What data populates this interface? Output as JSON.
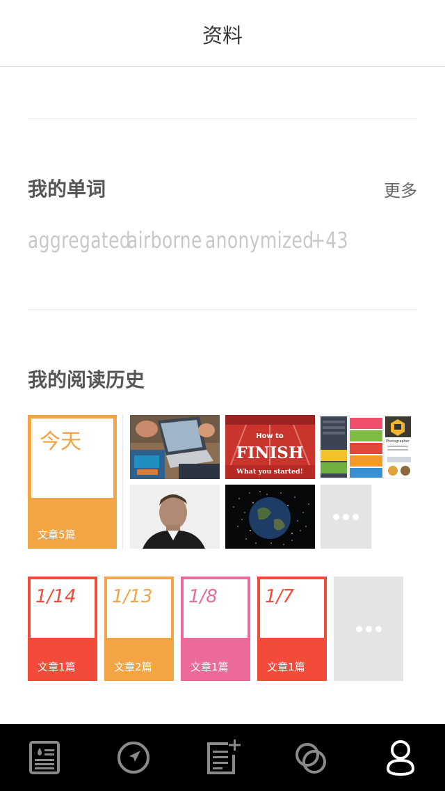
{
  "header": {
    "title": "资料"
  },
  "words_section": {
    "title": "我的单词",
    "more_label": "更多",
    "words": [
      "aggregated",
      "airborne",
      "anonymized",
      "+43"
    ]
  },
  "history_section": {
    "title": "我的阅读历史",
    "today": {
      "label": "今天",
      "count": "文章5篇",
      "color": "#f3a444"
    },
    "thumbnails": [
      {
        "name": "laptop-workspace-photo"
      },
      {
        "name": "how-to-finish-photo",
        "line1": "How to",
        "line2": "FINISH",
        "line3": "What you started!"
      },
      {
        "name": "app-screenshots-photo",
        "caption": "Photographer"
      },
      {
        "name": "man-portrait-photo"
      },
      {
        "name": "earth-space-debris-photo"
      }
    ],
    "days": [
      {
        "date": "1/14",
        "count": "文章1篇",
        "color": "#f24b3a"
      },
      {
        "date": "1/13",
        "count": "文章2篇",
        "color": "#f3a444"
      },
      {
        "date": "1/8",
        "count": "文章1篇",
        "color": "#ec6a9a"
      },
      {
        "date": "1/7",
        "count": "文章1篇",
        "color": "#f24b3a"
      }
    ]
  },
  "tabbar": {
    "items": [
      {
        "icon": "newspaper-icon",
        "active": false
      },
      {
        "icon": "compass-navigate-icon",
        "active": false
      },
      {
        "icon": "note-add-icon",
        "active": false
      },
      {
        "icon": "circles-overlap-icon",
        "active": false
      },
      {
        "icon": "profile-user-icon",
        "active": true
      }
    ]
  }
}
